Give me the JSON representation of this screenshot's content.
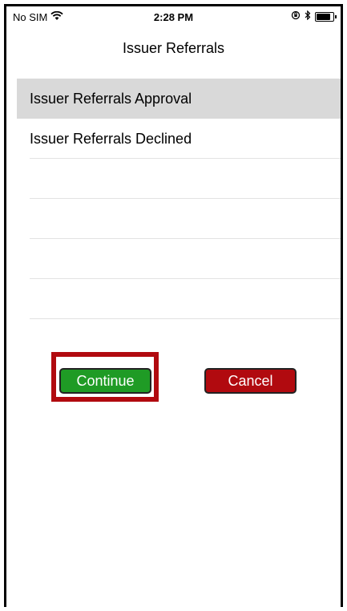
{
  "status": {
    "carrier": "No SIM",
    "time": "2:28 PM",
    "wifi_icon": "wifi-icon",
    "orientation_icon": "orientation-lock-icon",
    "bluetooth_icon": "bluetooth-icon",
    "battery_icon": "battery-icon"
  },
  "nav": {
    "title": "Issuer Referrals"
  },
  "list": {
    "items": [
      {
        "label": "Issuer Referrals Approval",
        "selected": true
      },
      {
        "label": "Issuer Referrals Declined",
        "selected": false
      },
      {
        "label": ""
      },
      {
        "label": ""
      },
      {
        "label": ""
      },
      {
        "label": ""
      }
    ]
  },
  "actions": {
    "continue_label": "Continue",
    "cancel_label": "Cancel",
    "continue_color": "#1f9b25",
    "cancel_color": "#b10a0f",
    "highlight_color": "#b10a0f"
  }
}
